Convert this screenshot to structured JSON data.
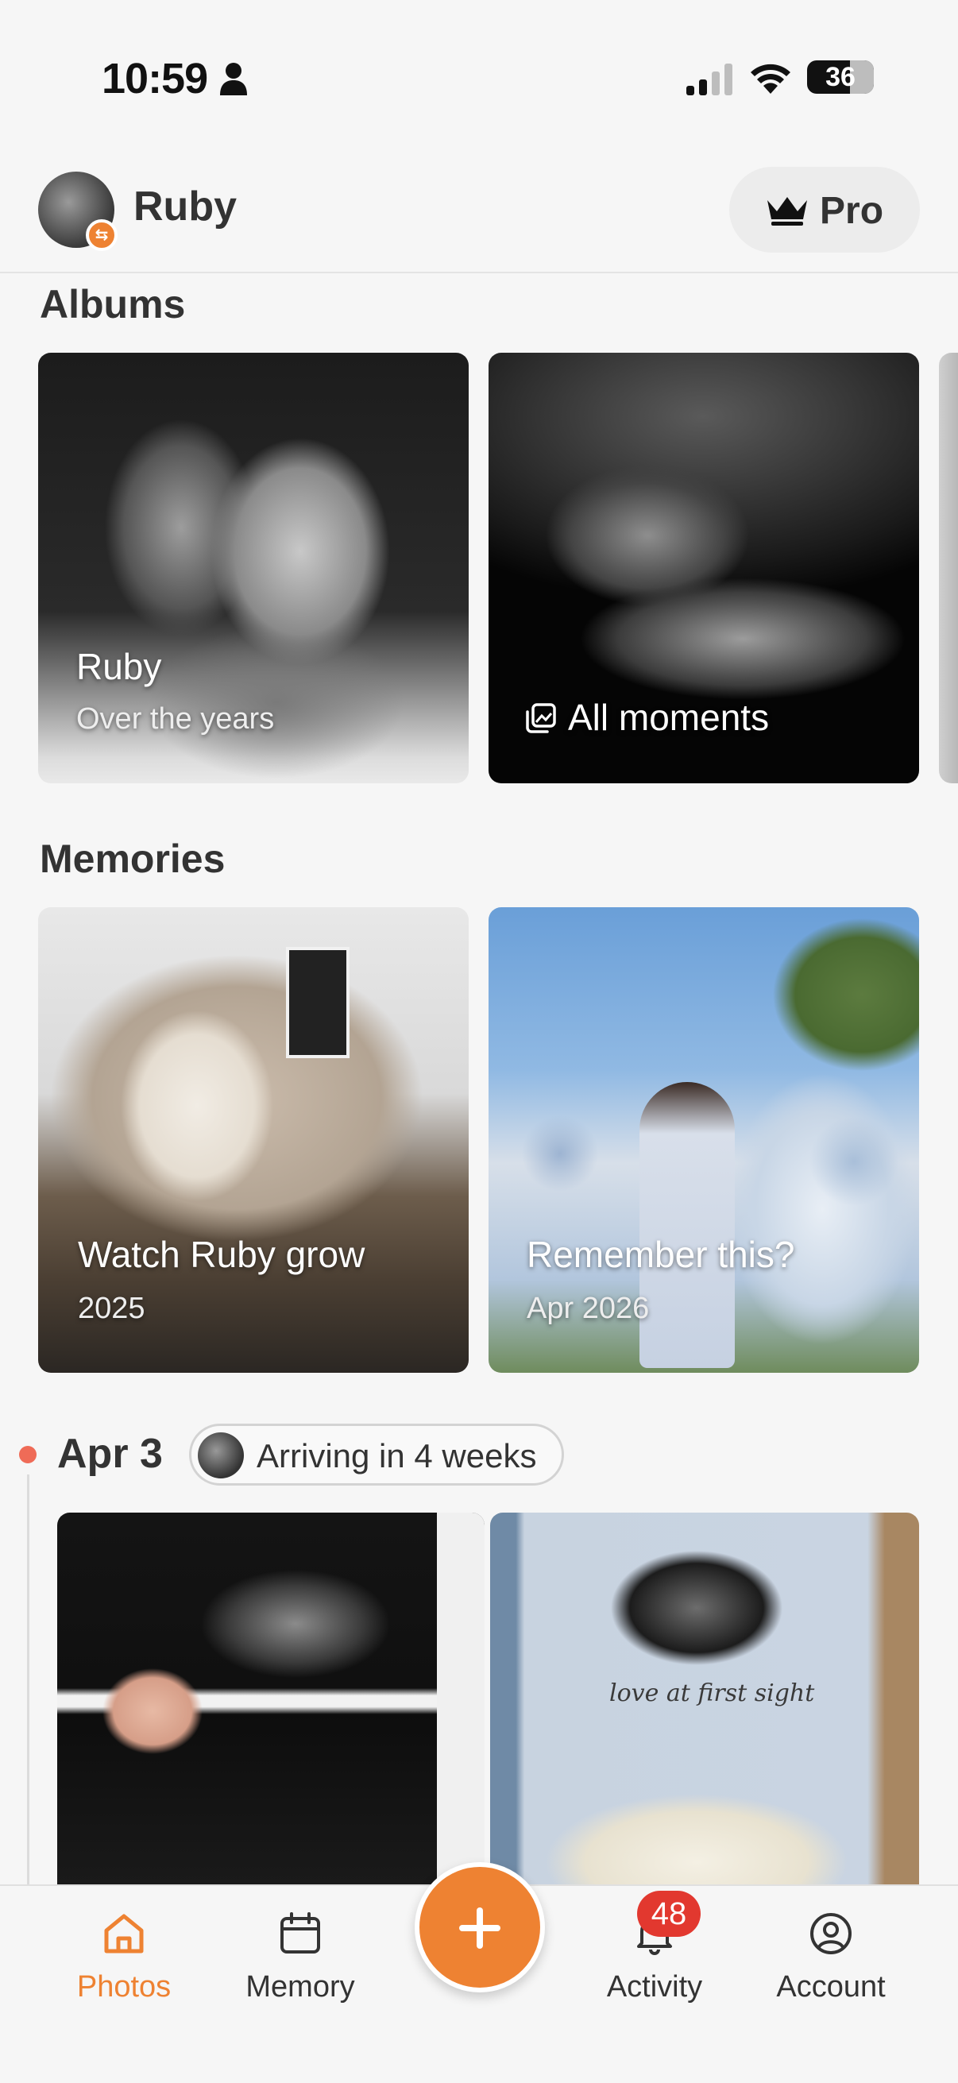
{
  "status_bar": {
    "time": "10:59",
    "battery": "36",
    "icons": [
      "person-icon",
      "signal-icon",
      "wifi-icon",
      "battery-icon"
    ]
  },
  "header": {
    "profile_name": "Ruby",
    "pro_label": "Pro"
  },
  "albums": {
    "title": "Albums",
    "items": [
      {
        "title": "Ruby",
        "subtitle": "Over the years"
      },
      {
        "title": "All moments",
        "icon": "gallery-icon"
      }
    ]
  },
  "memories": {
    "title": "Memories",
    "items": [
      {
        "title": "Watch Ruby grow",
        "subtitle": "2025"
      },
      {
        "title": "Remember this?",
        "subtitle": "Apr 2026"
      }
    ]
  },
  "timeline": {
    "date": "Apr 3",
    "chip": "Arriving in 4 weeks",
    "photo_caption": "love at first sight"
  },
  "tabbar": {
    "tabs": [
      {
        "label": "Photos",
        "icon": "home-icon",
        "active": true
      },
      {
        "label": "Memory",
        "icon": "calendar-icon"
      },
      {
        "label": "Activity",
        "icon": "bell-icon",
        "badge": "48"
      },
      {
        "label": "Account",
        "icon": "user-circle-icon"
      }
    ],
    "add_icon": "plus-icon"
  },
  "colors": {
    "accent": "#ee8232",
    "badge": "#e2382f",
    "timeline_dot": "#ef6b57",
    "background": "#f6f6f6"
  }
}
